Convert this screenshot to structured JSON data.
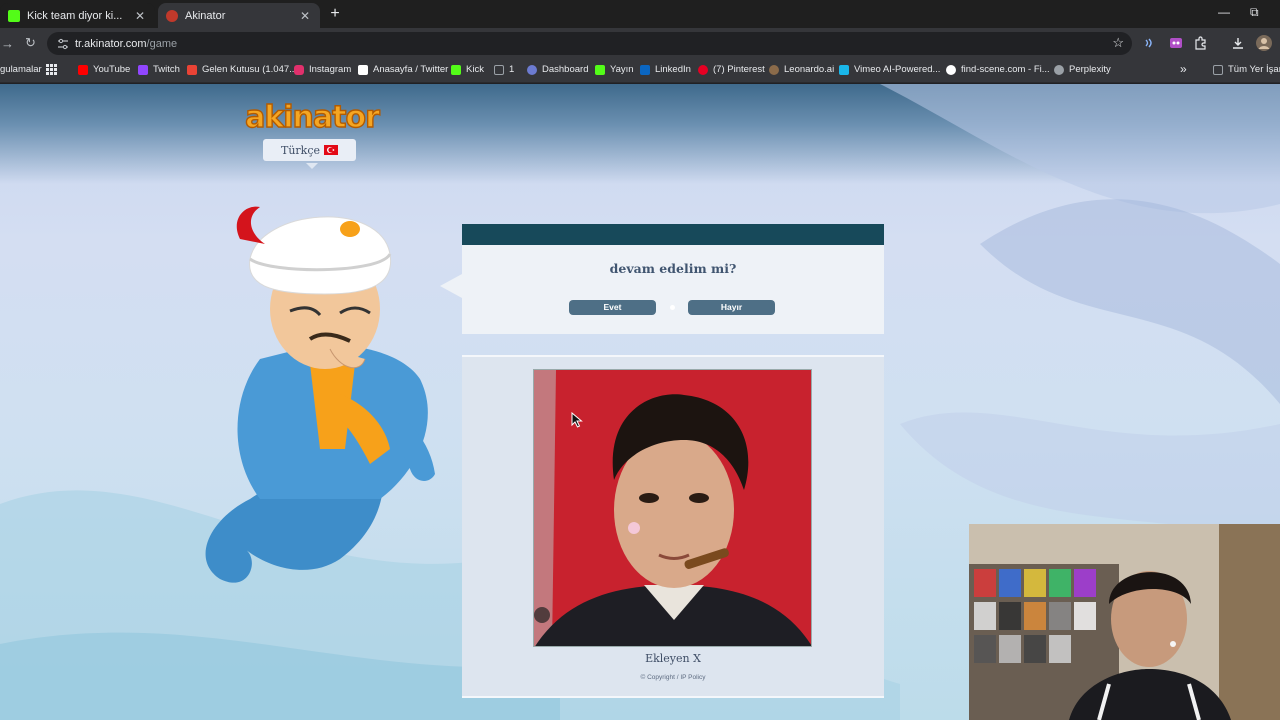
{
  "browser": {
    "tabs": [
      {
        "title": "Kick team diyor ki...",
        "favicon_color": "#53fc18",
        "close": "✕"
      },
      {
        "title": "Akinator",
        "favicon_color": "#c0392b",
        "close": "✕"
      }
    ],
    "newtab": "+",
    "window_controls": {
      "minimize": "—",
      "restore": "⧉"
    },
    "address": {
      "host": "tr.akinator.com",
      "path": "/game"
    },
    "star": "☆",
    "nav": {
      "back": "→",
      "reload": "↻"
    }
  },
  "bookmarks": [
    {
      "label": "gulamalar",
      "color": ""
    },
    {
      "label": "YouTube",
      "color": "#ff0000"
    },
    {
      "label": "Twitch",
      "color": "#9146ff"
    },
    {
      "label": "Gelen Kutusu (1.047...",
      "color": "#ea4335"
    },
    {
      "label": "Instagram",
      "color": "#e1306c"
    },
    {
      "label": "Anasayfa / Twitter",
      "color": "#ffffff"
    },
    {
      "label": "Kick",
      "color": "#53fc18"
    },
    {
      "label": "1",
      "color": "#9aa0a6"
    },
    {
      "label": "Dashboard",
      "color": "#6c7bd1"
    },
    {
      "label": "Yayın",
      "color": "#53fc18"
    },
    {
      "label": "LinkedIn",
      "color": "#0a66c2"
    },
    {
      "label": "(7) Pinterest",
      "color": "#e60023"
    },
    {
      "label": "Leonardo.ai",
      "color": "#8b6b4a"
    },
    {
      "label": "Vimeo AI-Powered...",
      "color": "#1ab7ea"
    },
    {
      "label": "find-scene.com - Fi...",
      "color": "#ffffff"
    },
    {
      "label": "Perplexity",
      "color": "#9aa0a6"
    },
    {
      "label": "Tüm Yer İşareti",
      "color": ""
    }
  ],
  "bookmarks_more": "»",
  "page": {
    "language_label": "Türkçe",
    "question": "devam edelim mi?",
    "answers": {
      "yes": "Evet",
      "no": "Hayır"
    },
    "photo_caption": "Ekleyen X",
    "copyright": "© Copyright / IP Policy"
  },
  "colors": {
    "header_bar": "#17495a",
    "answer_button": "#4e6f86",
    "flag_red": "#e30a17"
  }
}
